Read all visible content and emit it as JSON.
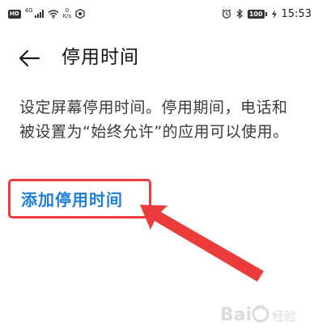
{
  "status_bar": {
    "hd": "HD",
    "network": "4G",
    "speed_value": "0",
    "speed_unit": "K/s",
    "battery": "100",
    "time": "15:53"
  },
  "header": {
    "title": "停用时间"
  },
  "main": {
    "description": "设定屏幕停用时间。停用期间，电话和被设置为“始终允许”的应用可以使用。",
    "add_link": "添加停用时间"
  },
  "icons": {
    "back": "back-arrow-icon",
    "wifi": "wifi-icon",
    "signal": "signal-icon",
    "alarm": "alarm-icon",
    "bluetooth": "bluetooth-icon",
    "battery": "battery-icon",
    "charging": "charging-icon"
  },
  "colors": {
    "link": "#1f7fd8",
    "annotation": "#ec3b3b"
  }
}
